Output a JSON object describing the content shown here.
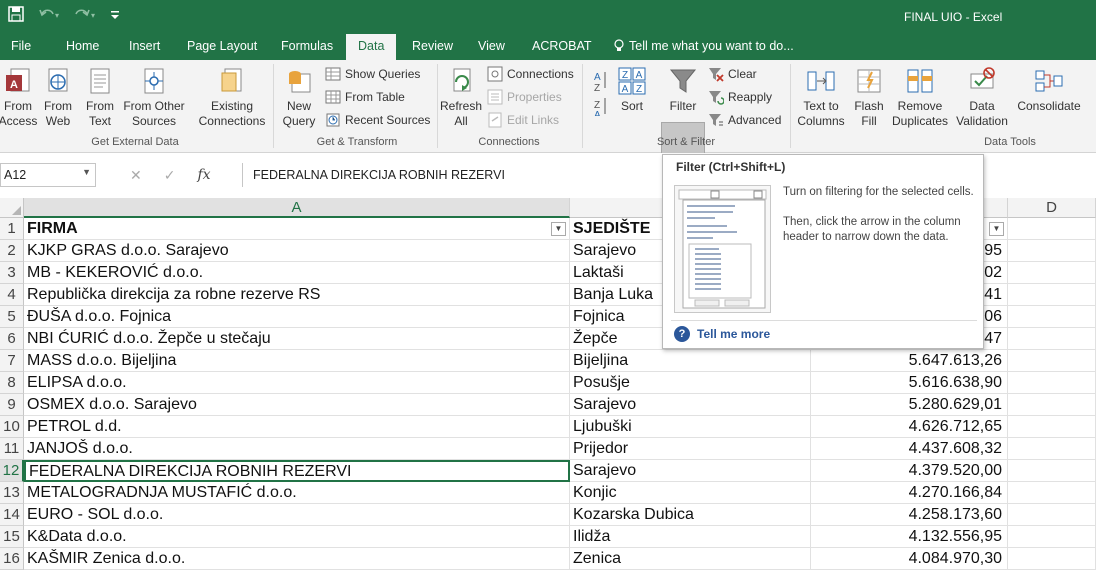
{
  "window": {
    "title": "FINAL UIO - Excel"
  },
  "qat": {
    "save": "save-icon",
    "undo": "undo-icon",
    "redo": "redo-icon",
    "customize": "customize-icon"
  },
  "menu": {
    "file": "File",
    "home": "Home",
    "insert": "Insert",
    "page_layout": "Page Layout",
    "formulas": "Formulas",
    "data": "Data",
    "review": "Review",
    "view": "View",
    "acrobat": "ACROBAT",
    "tell_me": "Tell me what you want to do..."
  },
  "ribbon": {
    "get_external": {
      "label": "Get External Data",
      "from_access": "From Access",
      "from_web": "From Web",
      "from_text": "From Text",
      "from_other": "From Other Sources",
      "existing": "Existing Connections"
    },
    "get_transform": {
      "label": "Get & Transform",
      "new_query": "New Query",
      "show_queries": "Show Queries",
      "from_table": "From Table",
      "recent_sources": "Recent Sources"
    },
    "connections": {
      "label": "Connections",
      "refresh_all": "Refresh All",
      "connections": "Connections",
      "properties": "Properties",
      "edit_links": "Edit Links"
    },
    "sort_filter": {
      "label": "Sort & Filter",
      "sort": "Sort",
      "filter": "Filter",
      "clear": "Clear",
      "reapply": "Reapply",
      "advanced": "Advanced"
    },
    "data_tools": {
      "label": "Data Tools",
      "text_to_columns": "Text to Columns",
      "flash_fill": "Flash Fill",
      "remove_duplicates": "Remove Duplicates",
      "data_validation": "Data Validation",
      "consolidate": "Consolidate"
    }
  },
  "formula_bar": {
    "name_box": "A12",
    "cancel": "✕",
    "enter": "✓",
    "fx": "fx",
    "content": "FEDERALNA DIREKCIJA ROBNIH REZERVI"
  },
  "columns": {
    "a": "A",
    "d": "D"
  },
  "rows": [
    {
      "n": "1",
      "firma": "FIRMA",
      "sjediste": "SJEDIŠTE",
      "iznos": ""
    },
    {
      "n": "2",
      "firma": "KJKP GRAS d.o.o. Sarajevo",
      "sjediste": "Sarajevo",
      "iznos": "95"
    },
    {
      "n": "3",
      "firma": "MB - KEKEROVIĆ d.o.o.",
      "sjediste": "Laktaši",
      "iznos": "02"
    },
    {
      "n": "4",
      "firma": "Republička direkcija za robne rezerve RS",
      "sjediste": "Banja Luka",
      "iznos": "41"
    },
    {
      "n": "5",
      "firma": "ĐUŠA d.o.o. Fojnica",
      "sjediste": "Fojnica",
      "iznos": "06"
    },
    {
      "n": "6",
      "firma": "NBI ĆURIĆ d.o.o. Žepče u stečaju",
      "sjediste": "Žepče",
      "iznos": "47"
    },
    {
      "n": "7",
      "firma": "MASS d.o.o. Bijeljina",
      "sjediste": "Bijeljina",
      "iznos": "5.647.613,26"
    },
    {
      "n": "8",
      "firma": "ELIPSA d.o.o.",
      "sjediste": "Posušje",
      "iznos": "5.616.638,90"
    },
    {
      "n": "9",
      "firma": "OSMEX d.o.o. Sarajevo",
      "sjediste": "Sarajevo",
      "iznos": "5.280.629,01"
    },
    {
      "n": "10",
      "firma": "PETROL d.d.",
      "sjediste": "Ljubuški",
      "iznos": "4.626.712,65"
    },
    {
      "n": "11",
      "firma": "JANJOŠ d.o.o.",
      "sjediste": "Prijedor",
      "iznos": "4.437.608,32"
    },
    {
      "n": "12",
      "firma": "FEDERALNA DIREKCIJA ROBNIH REZERVI",
      "sjediste": "Sarajevo",
      "iznos": "4.379.520,00"
    },
    {
      "n": "13",
      "firma": "METALOGRADNJA MUSTAFIĆ d.o.o.",
      "sjediste": "Konjic",
      "iznos": "4.270.166,84"
    },
    {
      "n": "14",
      "firma": "EURO - SOL  d.o.o.",
      "sjediste": "Kozarska Dubica",
      "iznos": "4.258.173,60"
    },
    {
      "n": "15",
      "firma": "K&Data d.o.o.",
      "sjediste": "Ilidža",
      "iznos": "4.132.556,95"
    },
    {
      "n": "16",
      "firma": "KAŠMIR Zenica d.o.o.",
      "sjediste": "Zenica",
      "iznos": "4.084.970,30"
    }
  ],
  "tooltip": {
    "title": "Filter (Ctrl+Shift+L)",
    "line1": "Turn on filtering for the selected cells.",
    "line2": "Then, click the arrow in the column header to narrow down the data.",
    "more": "Tell me more"
  },
  "colors": {
    "excel_green": "#217346",
    "ribbon_bg": "#f3f3f3",
    "link_blue": "#2b579a"
  }
}
